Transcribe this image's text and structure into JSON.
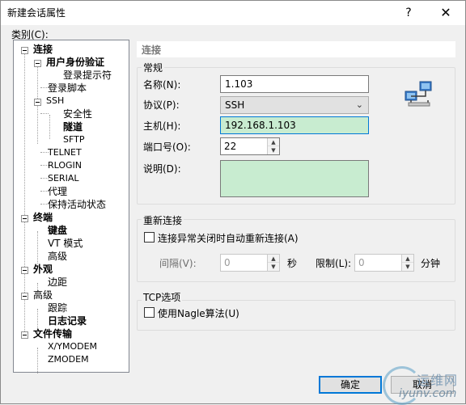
{
  "window": {
    "title": "新建会话属性",
    "help": "?",
    "close": "✕"
  },
  "category_label": "类别(C):",
  "tree": {
    "connection": "连接",
    "user_auth": "用户身份验证",
    "login_prompt": "登录提示符",
    "login_script": "登录脚本",
    "ssh": "SSH",
    "security": "安全性",
    "tunnel": "隧道",
    "sftp": "SFTP",
    "telnet": "TELNET",
    "rlogin": "RLOGIN",
    "serial": "SERIAL",
    "proxy": "代理",
    "keepalive": "保持活动状态",
    "terminal": "终端",
    "keyboard": "键盘",
    "vt_mode": "VT 模式",
    "advanced": "高级",
    "appearance": "外观",
    "margin": "边距",
    "advanced2": "高级",
    "trace": "跟踪",
    "logging": "日志记录",
    "file_transfer": "文件传输",
    "xymodem": "X/YMODEM",
    "zmodem": "ZMODEM"
  },
  "panel": {
    "header": "连接",
    "general": {
      "title": "常规",
      "name_label": "名称(N):",
      "name_value": "1.103",
      "protocol_label": "协议(P):",
      "protocol_value": "SSH",
      "host_label": "主机(H):",
      "host_value": "192.168.1.103",
      "port_label": "端口号(O):",
      "port_value": "22",
      "desc_label": "说明(D):",
      "desc_value": ""
    },
    "reconnect": {
      "title": "重新连接",
      "checkbox_label": "连接异常关闭时自动重新连接(A)",
      "interval_label": "间隔(V):",
      "interval_value": "0",
      "seconds_unit": "秒",
      "limit_label": "限制(L):",
      "limit_value": "0",
      "minutes_unit": "分钟"
    },
    "tcp": {
      "title": "TCP选项",
      "nagle_label": "使用Nagle算法(U)"
    }
  },
  "buttons": {
    "ok": "确定",
    "cancel": "取消"
  },
  "watermark": {
    "line1": "运维网",
    "line2": "iyunv.com"
  }
}
